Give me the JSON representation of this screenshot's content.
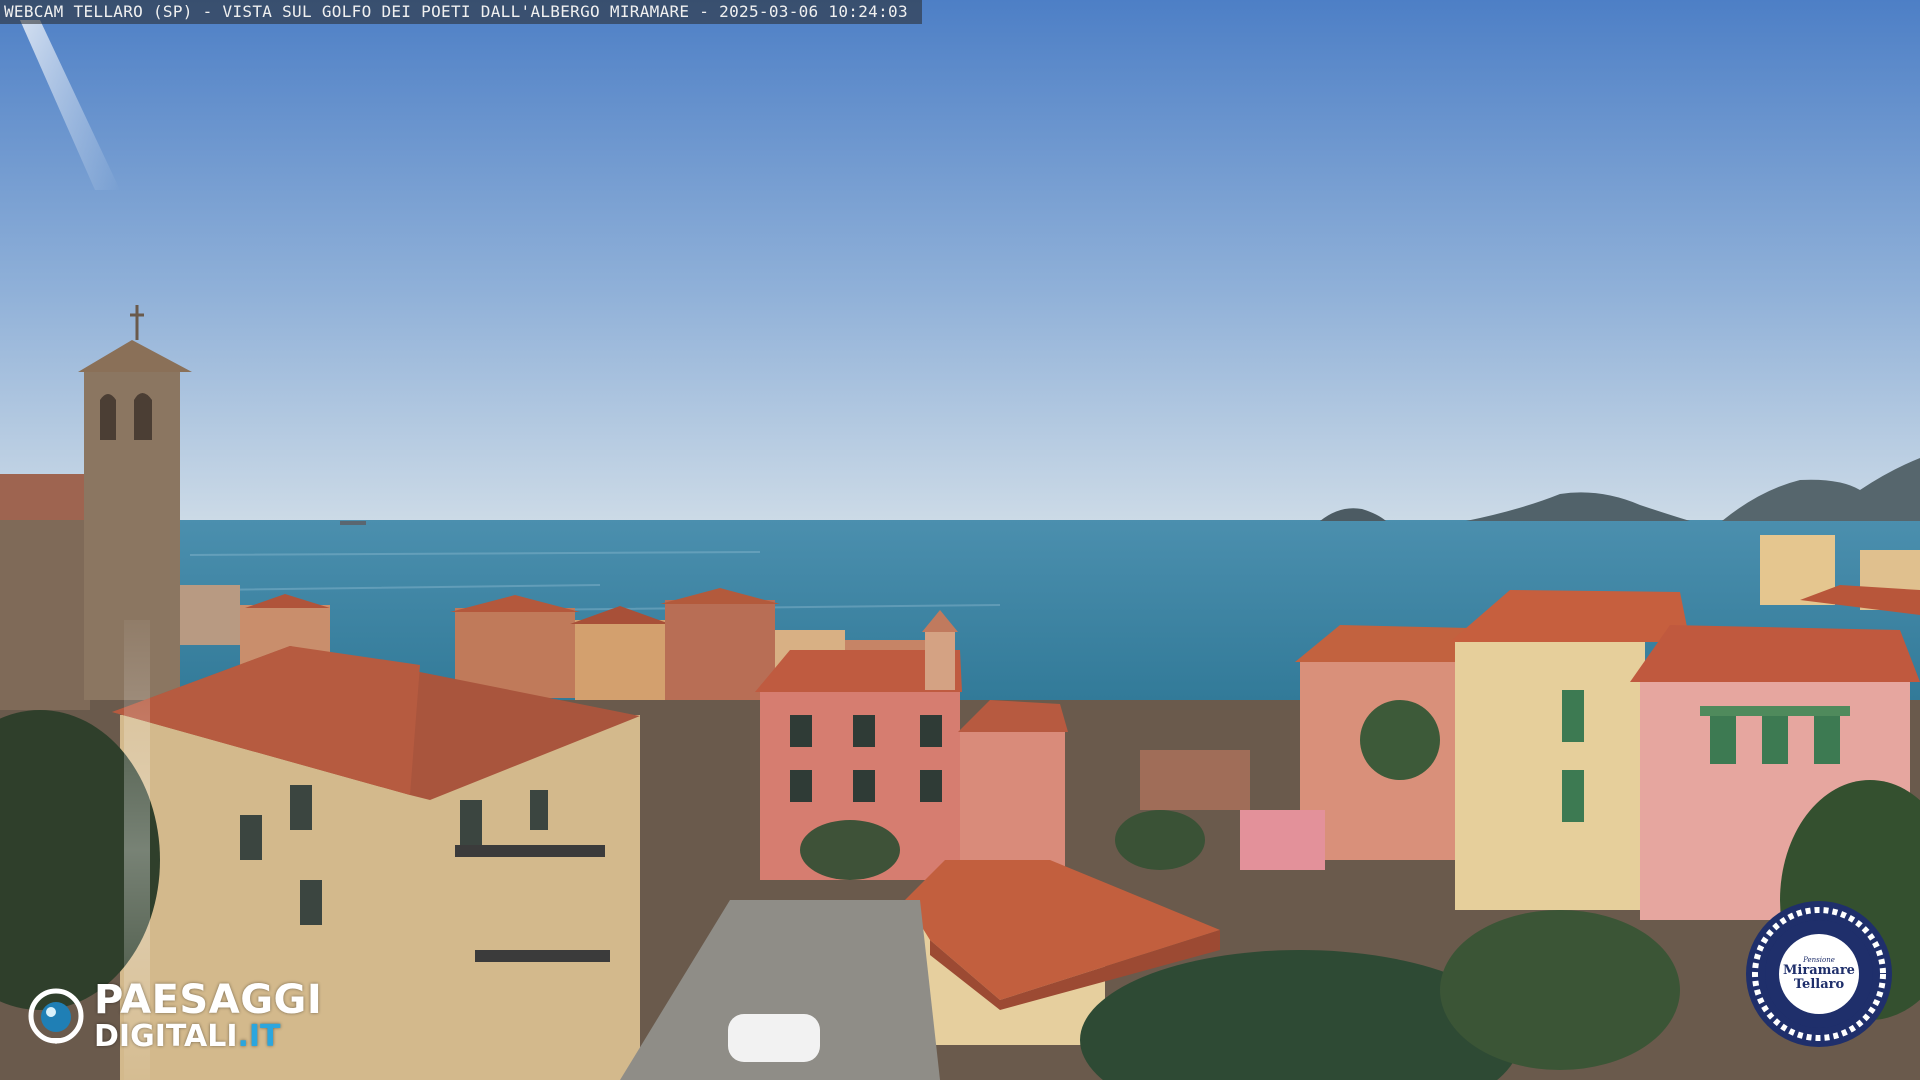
{
  "caption": {
    "text": "WEBCAM TELLARO (SP) - VISTA SUL GOLFO DEI POETI DALL'ALBERGO MIRAMARE - 2025-03-06 10:24:03"
  },
  "brand_logo": {
    "line1": "PAESAGGI",
    "line2_main": "DIGITALI",
    "line2_domain": ".IT",
    "icon": "eye-icon"
  },
  "hotel_seal": {
    "small_text": "Pensione",
    "name_line1": "Miramare",
    "name_line2": "Tellaro",
    "icon": "rope-badge-icon"
  },
  "colors": {
    "sky_top": "#4f82c9",
    "sky_horizon": "#c9d9e6",
    "sea": "#2f7e9c",
    "roof": "#b8563a",
    "accent_blue": "#2ba6de",
    "seal_navy": "#1f2f6b"
  }
}
